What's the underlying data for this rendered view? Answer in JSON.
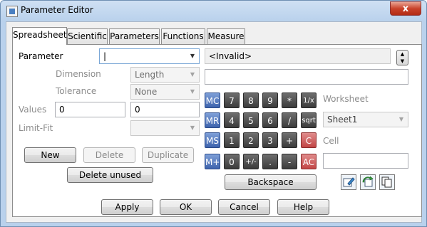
{
  "window": {
    "title": "Parameter Editor",
    "close_glyph": "x"
  },
  "tabs": [
    {
      "label": "Spreadsheet"
    },
    {
      "label": "Scientific"
    },
    {
      "label": "Parameters"
    },
    {
      "label": "Functions"
    },
    {
      "label": "Measure"
    }
  ],
  "form": {
    "parameter_label": "Parameter",
    "parameter_value": "|",
    "dimension_label": "Dimension",
    "dimension_value": "Length",
    "tolerance_label": "Tolerance",
    "tolerance_value": "None",
    "values_label": "Values",
    "value1": "0",
    "value2": "0",
    "limitfit_label": "Limit-Fit",
    "limitfit_value": ""
  },
  "expression": {
    "status": "<Invalid>",
    "input": ""
  },
  "buttons": {
    "new": "New",
    "delete": "Delete",
    "duplicate": "Duplicate",
    "delete_unused": "Delete unused",
    "backspace": "Backspace",
    "apply": "Apply",
    "ok": "OK",
    "cancel": "Cancel",
    "help": "Help"
  },
  "keypad": {
    "row1": [
      "MC",
      "7",
      "8",
      "9",
      "*",
      "1/x"
    ],
    "row2": [
      "MR",
      "4",
      "5",
      "6",
      "/",
      "sqrt"
    ],
    "row3": [
      "MS",
      "1",
      "2",
      "3",
      "+",
      "C"
    ],
    "row4": [
      "M+",
      "0",
      "+/-",
      ".",
      "-",
      "AC"
    ]
  },
  "worksheet": {
    "label": "Worksheet",
    "value": "Sheet1"
  },
  "cell": {
    "label": "Cell",
    "value": ""
  },
  "icons": {
    "edit": "edit-cell-icon",
    "refresh": "refresh-icon",
    "copy": "copy-icon"
  },
  "colors": {
    "memory_key": "#3e63ad",
    "digit_key": "#3b3b3b",
    "clear_key": "#c24646"
  }
}
